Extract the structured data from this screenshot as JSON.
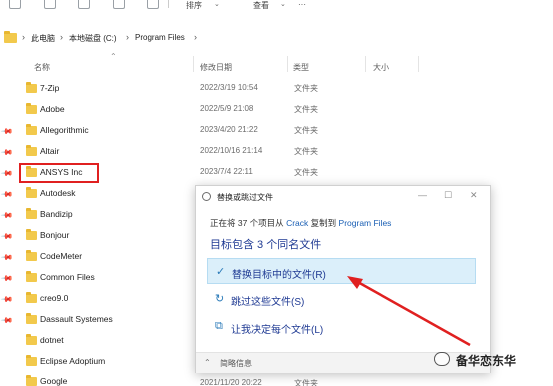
{
  "toolbar": {
    "sort_label": "排序",
    "view_label": "查看"
  },
  "breadcrumb": {
    "items": [
      "此电脑",
      "本地磁盘 (C:)",
      "Program Files"
    ],
    "separator": "›"
  },
  "columns": {
    "name": "名称",
    "date": "修改日期",
    "type": "类型",
    "size": "大小"
  },
  "files": [
    {
      "name": "7-Zip",
      "date": "2022/3/19 10:54",
      "type": "文件夹"
    },
    {
      "name": "Adobe",
      "date": "2022/5/9 21:08",
      "type": "文件夹"
    },
    {
      "name": "Allegorithmic",
      "date": "2023/4/20 21:22",
      "type": "文件夹"
    },
    {
      "name": "Altair",
      "date": "2022/10/16 21:14",
      "type": "文件夹"
    },
    {
      "name": "ANSYS Inc",
      "date": "2023/7/4 22:11",
      "type": "文件夹"
    },
    {
      "name": "Autodesk",
      "date": "",
      "type": ""
    },
    {
      "name": "Bandizip",
      "date": "",
      "type": ""
    },
    {
      "name": "Bonjour",
      "date": "",
      "type": ""
    },
    {
      "name": "CodeMeter",
      "date": "",
      "type": ""
    },
    {
      "name": "Common Files",
      "date": "",
      "type": ""
    },
    {
      "name": "creo9.0",
      "date": "",
      "type": ""
    },
    {
      "name": "Dassault Systemes",
      "date": "",
      "type": ""
    },
    {
      "name": "dotnet",
      "date": "",
      "type": ""
    },
    {
      "name": "Eclipse Adoptium",
      "date": "",
      "type": ""
    },
    {
      "name": "Google",
      "date": "",
      "type": ""
    }
  ],
  "partial_last_row": {
    "date": "2021/11/20 20:22",
    "type": "文件夹"
  },
  "dialog": {
    "title": "替换或跳过文件",
    "line1_prefix": "正在将 37 个项目从",
    "line1_source": "Crack",
    "line1_middle": "复制到",
    "line1_dest": "Program Files",
    "heading": "目标包含 3 个同名文件",
    "options": [
      {
        "icon": "check-icon",
        "label": "替换目标中的文件(R)",
        "selected": true
      },
      {
        "icon": "skip-icon",
        "label": "跳过这些文件(S)",
        "selected": false
      },
      {
        "icon": "decide-icon",
        "label": "让我决定每个文件(L)",
        "selected": false
      }
    ],
    "footer": "简略信息"
  },
  "watermark": {
    "text": "备华恋东华"
  },
  "colors": {
    "accent": "#1f3a93",
    "selected_bg": "#dbeffa",
    "highlight_red": "#e02020",
    "folder_yellow": "#f2c94c"
  }
}
